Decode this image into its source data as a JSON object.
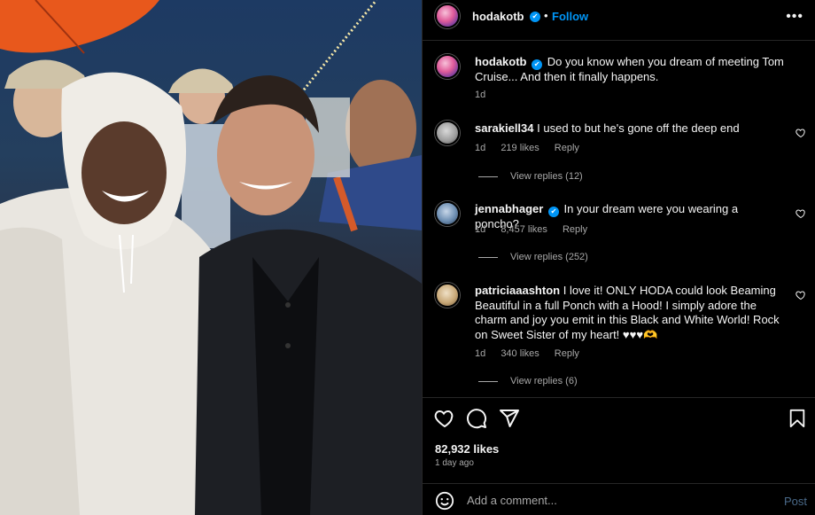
{
  "post": {
    "author": "hodakotb",
    "verified_badge": "✔",
    "follow_label": "Follow",
    "separator": "•",
    "more_label": "•••",
    "caption": "Do you know when you dream of meeting Tom Cruise... And then it finally happens.",
    "caption_age": "1d",
    "likes": "82,932 likes",
    "posted_ago": "1 day ago"
  },
  "comments": [
    {
      "user": "sarakiell34",
      "text": "I used to but he's gone off the deep end",
      "age": "1d",
      "likes": "219 likes",
      "reply_label": "Reply",
      "view_replies": "View replies (12)"
    },
    {
      "user": "jennabhager",
      "verified": "✔",
      "text": "In your dream were you wearing a poncho?",
      "age": "1d",
      "likes": "8,457 likes",
      "reply_label": "Reply",
      "view_replies": "View replies (252)"
    },
    {
      "user": "patriciaaashton",
      "text": "I love it! ONLY HODA could look Beaming Beautiful in a full Ponch with a Hood! I simply adore the charm and joy you emit in this Black and White World! Rock on Sweet Sister of my heart! ♥♥♥🫶",
      "age": "1d",
      "likes": "340 likes",
      "reply_label": "Reply",
      "view_replies": "View replies (6)"
    }
  ],
  "composer": {
    "placeholder": "Add a comment...",
    "post_label": "Post"
  },
  "icons": {
    "like": "heart-icon",
    "comment": "comment-icon",
    "share": "paper-plane-icon",
    "save": "bookmark-icon",
    "emoji": "smiley-icon",
    "comment_like": "heart-outline-icon",
    "options": "more-dots-icon"
  },
  "colors": {
    "background": "#000000",
    "accent": "#0095f6",
    "muted_text": "#a8a8a8",
    "divider": "#262626"
  }
}
